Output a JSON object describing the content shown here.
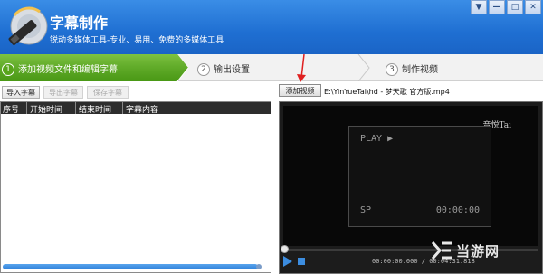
{
  "app": {
    "title": "字幕制作",
    "subtitle": "锐动多媒体工具-专业、易用、免费的多媒体工具"
  },
  "window_controls": [
    {
      "name": "menu-icon",
      "glyph": "▼"
    },
    {
      "name": "minimize-icon",
      "glyph": "—"
    },
    {
      "name": "maximize-icon",
      "glyph": "□"
    },
    {
      "name": "close-icon",
      "glyph": "✕"
    }
  ],
  "steps": [
    {
      "num": "1",
      "label": "添加视频文件和编辑字幕",
      "active": true
    },
    {
      "num": "2",
      "label": "输出设置",
      "active": false
    },
    {
      "num": "3",
      "label": "制作视频",
      "active": false
    }
  ],
  "left_toolbar": {
    "import_label": "导入字幕",
    "export_label": "导出字幕",
    "save_label": "保存字幕"
  },
  "table": {
    "columns": [
      "序号",
      "开始时间",
      "结束时间",
      "字幕内容"
    ],
    "rows": []
  },
  "right_toolbar": {
    "add_video_label": "添加视频",
    "file_path": "E:\\YinYueTai\\hd - 梦天歌 官方版.mp4"
  },
  "video": {
    "play_text": "PLAY ▶",
    "sp_text": "SP",
    "timecode": "00:00:00",
    "logo_text": "音悦Tai"
  },
  "player": {
    "time_readout": "00:00:00.000 / 00:04:31.818",
    "progress": 0.0
  },
  "watermark": {
    "text": "当游网"
  },
  "colors": {
    "titlebar": "#1f6fd2",
    "step_active": "#58a51b",
    "accent_blue": "#3c8de0",
    "annotation_red": "#e02020"
  }
}
